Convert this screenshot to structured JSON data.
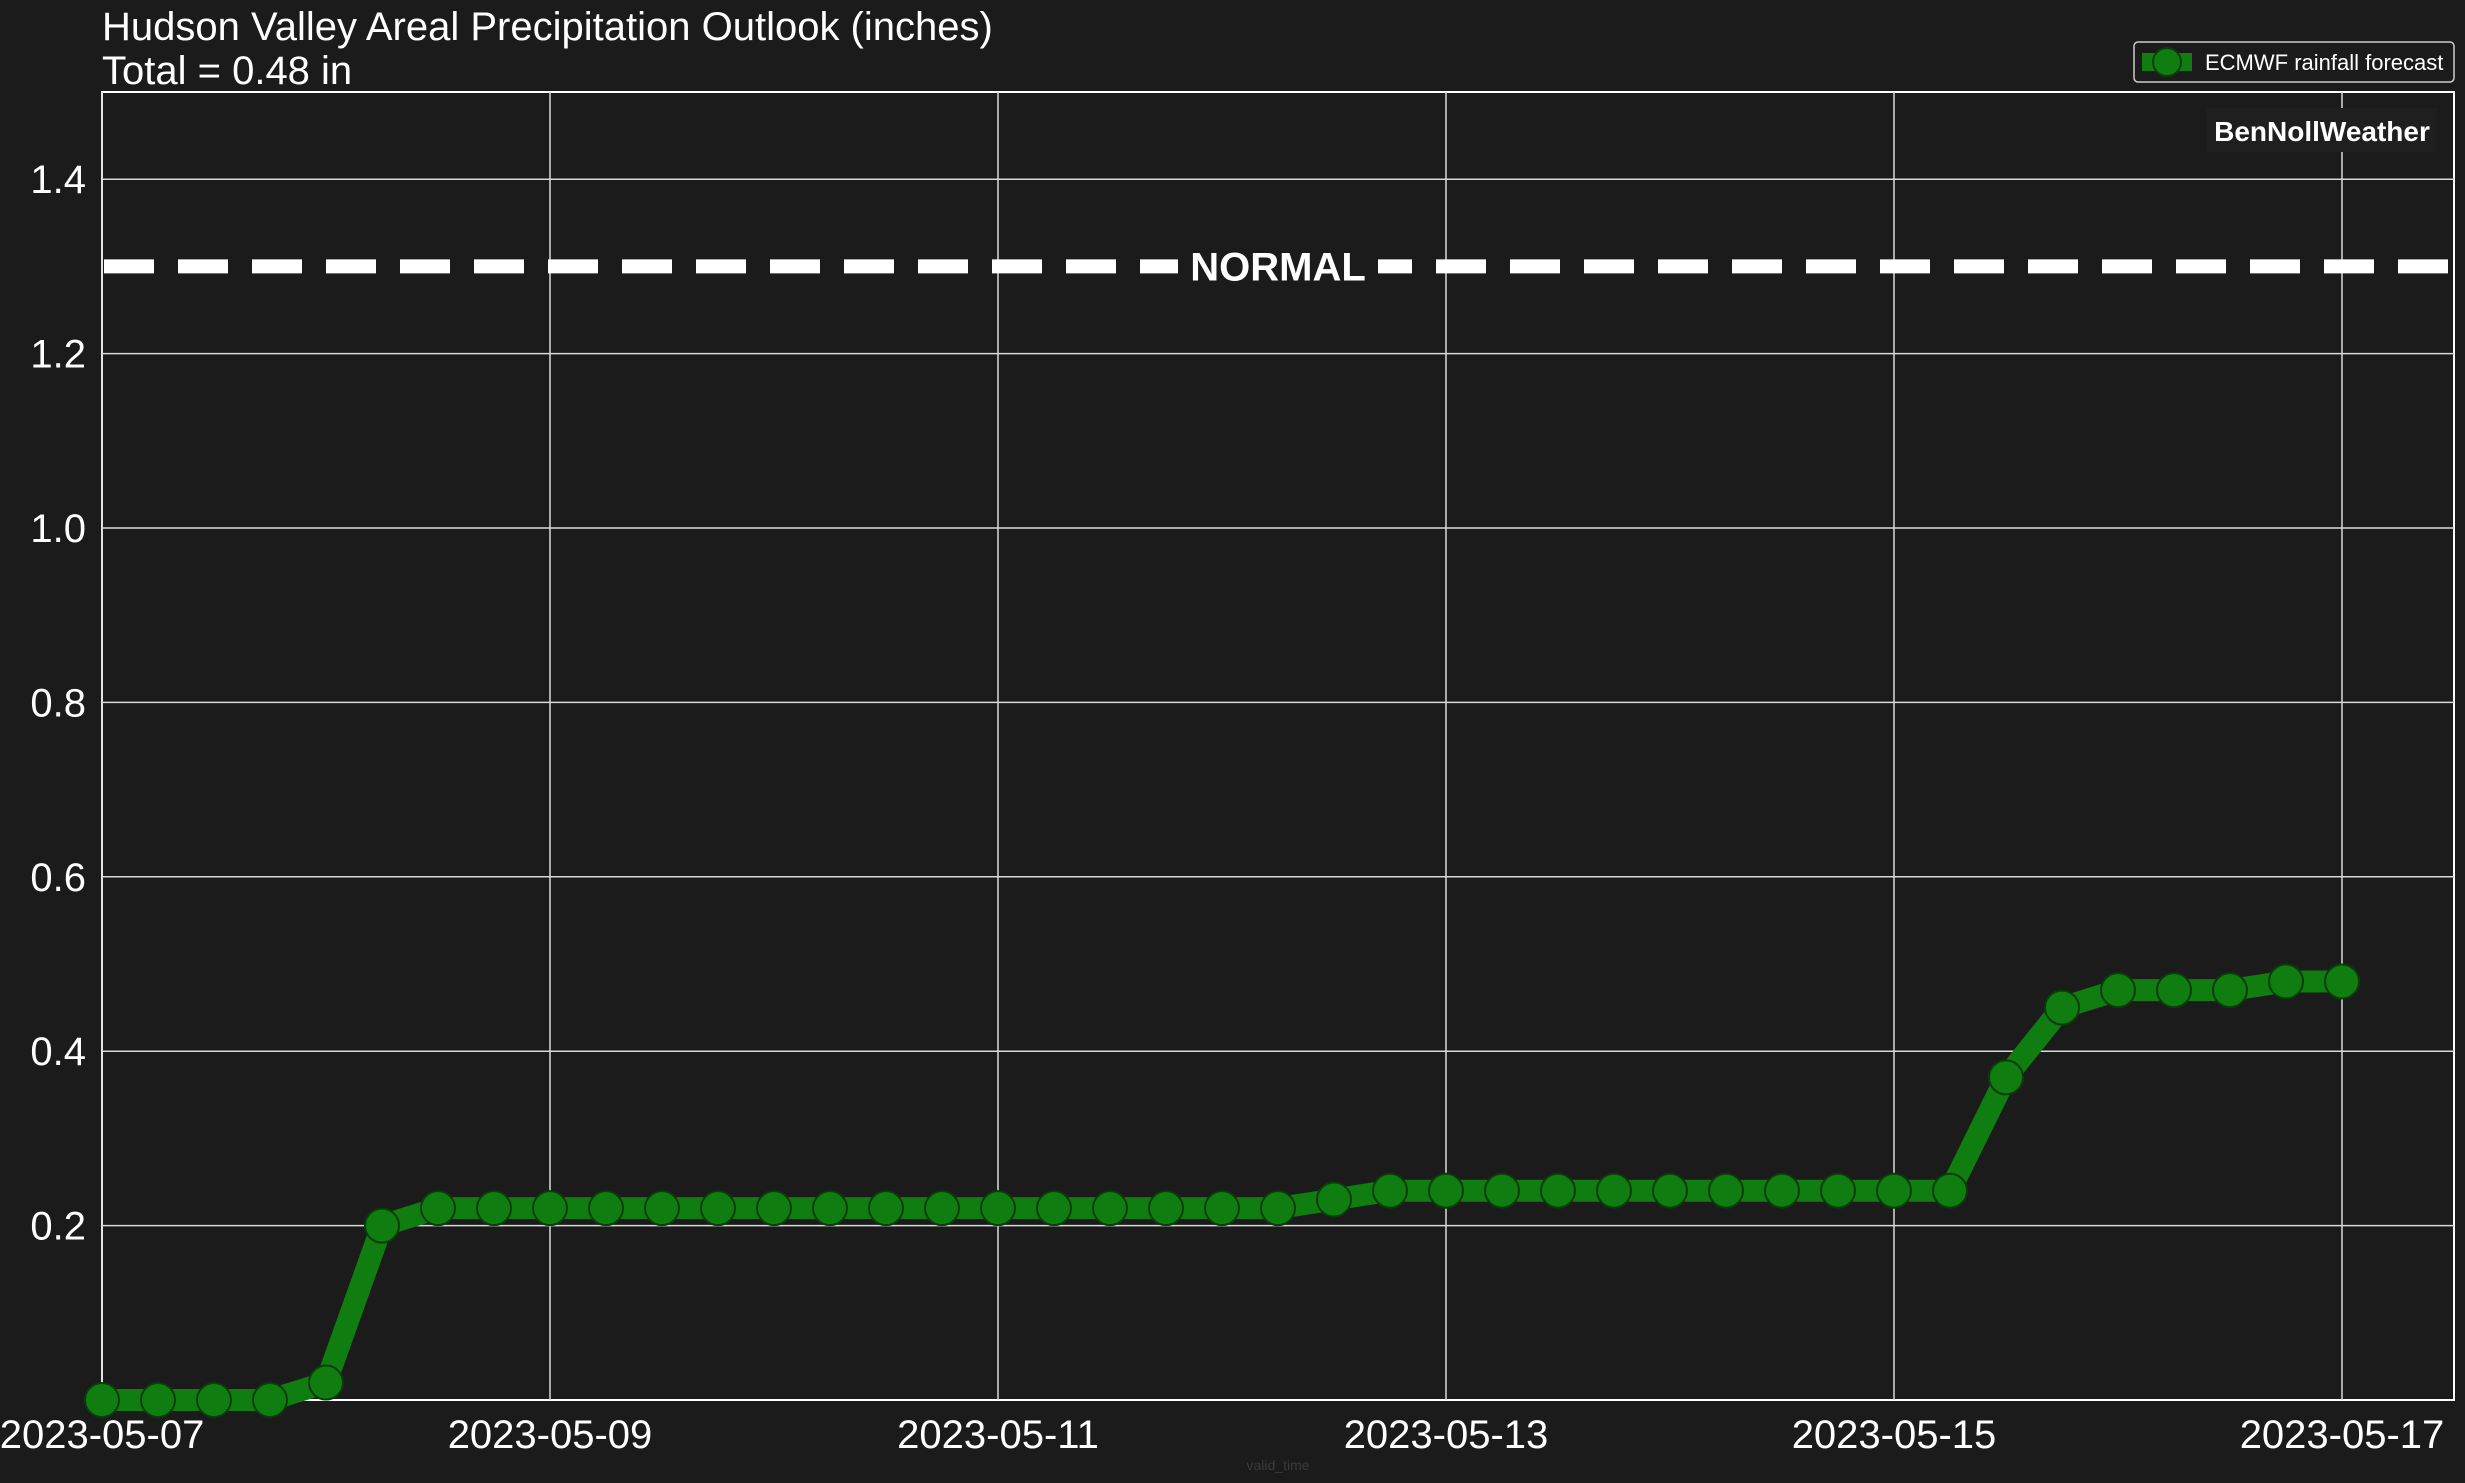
{
  "chart_data": {
    "type": "line",
    "title": "Hudson Valley Areal Precipitation Outlook (inches)",
    "subtitle": "Total = 0.48 in",
    "xlabel": "valid_time",
    "ylabel": "",
    "xlim": [
      "2023-05-07T00:00",
      "2023-05-17T12:00"
    ],
    "ylim": [
      0.0,
      1.5
    ],
    "x_ticks": [
      "2023-05-07",
      "2023-05-09",
      "2023-05-11",
      "2023-05-13",
      "2023-05-15",
      "2023-05-17"
    ],
    "y_ticks": [
      0.2,
      0.4,
      0.6,
      0.8,
      1.0,
      1.2,
      1.4
    ],
    "grid": true,
    "legend_position": "top-right",
    "watermark": "BenNollWeather",
    "reference_line": {
      "label": "NORMAL",
      "value": 1.3,
      "style": "dashed",
      "color": "#ffffff"
    },
    "series": [
      {
        "name": "ECMWF rainfall forecast",
        "color": "#0f7d0f",
        "marker": "circle",
        "x": [
          "2023-05-07T00:00",
          "2023-05-07T06:00",
          "2023-05-07T12:00",
          "2023-05-07T18:00",
          "2023-05-08T00:00",
          "2023-05-08T06:00",
          "2023-05-08T12:00",
          "2023-05-08T18:00",
          "2023-05-09T00:00",
          "2023-05-09T06:00",
          "2023-05-09T12:00",
          "2023-05-09T18:00",
          "2023-05-10T00:00",
          "2023-05-10T06:00",
          "2023-05-10T12:00",
          "2023-05-10T18:00",
          "2023-05-11T00:00",
          "2023-05-11T06:00",
          "2023-05-11T12:00",
          "2023-05-11T18:00",
          "2023-05-12T00:00",
          "2023-05-12T06:00",
          "2023-05-12T12:00",
          "2023-05-12T18:00",
          "2023-05-13T00:00",
          "2023-05-13T06:00",
          "2023-05-13T12:00",
          "2023-05-13T18:00",
          "2023-05-14T00:00",
          "2023-05-14T06:00",
          "2023-05-14T12:00",
          "2023-05-14T18:00",
          "2023-05-15T00:00",
          "2023-05-15T06:00",
          "2023-05-15T12:00",
          "2023-05-15T18:00",
          "2023-05-16T00:00",
          "2023-05-16T06:00",
          "2023-05-16T12:00",
          "2023-05-16T18:00",
          "2023-05-17T00:00"
        ],
        "values": [
          0.0,
          0.0,
          0.0,
          0.0,
          0.02,
          0.2,
          0.22,
          0.22,
          0.22,
          0.22,
          0.22,
          0.22,
          0.22,
          0.22,
          0.22,
          0.22,
          0.22,
          0.22,
          0.22,
          0.22,
          0.22,
          0.22,
          0.23,
          0.24,
          0.24,
          0.24,
          0.24,
          0.24,
          0.24,
          0.24,
          0.24,
          0.24,
          0.24,
          0.24,
          0.37,
          0.45,
          0.47,
          0.47,
          0.47,
          0.48,
          0.48
        ]
      }
    ]
  }
}
